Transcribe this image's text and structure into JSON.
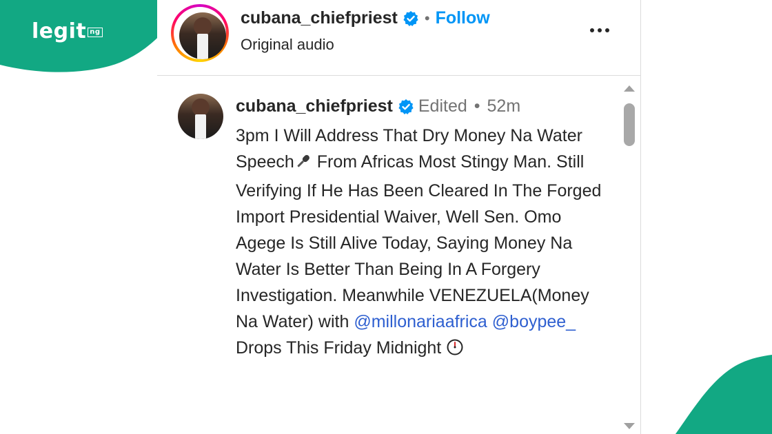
{
  "watermark": {
    "brand": "legit",
    "suffix": "ng"
  },
  "header": {
    "username": "cubana_chiefpriest",
    "separator": "•",
    "follow_label": "Follow",
    "subtitle": "Original audio",
    "more_icon": "more-horizontal-icon"
  },
  "comment": {
    "username": "cubana_chiefpriest",
    "edited": "Edited",
    "separator": "•",
    "time": "52m",
    "text_part1": "3pm I Will Address That Dry Money Na Water Speech",
    "text_part2": " From Africas Most Stingy Man. Still Verifying If He Has Been Cleared In The Forged Import Presidential Waiver, Well Sen. Omo Agege Is Still Alive Today, Saying Money Na Water Is Better Than Being In A Forgery Investigation. Meanwhile VENEZUELA(Money Na Water) with ",
    "mention1": "@millonariaafrica",
    "mention2": "@boypee_",
    "text_part3": " Drops This Friday Midnight ",
    "emoji1": "microphone-icon",
    "emoji2": "clock-icon"
  },
  "colors": {
    "brand_green": "#12a883",
    "follow_blue": "#0095f6",
    "mention_blue": "#2e5fd0",
    "verified_blue": "#0095f6"
  }
}
